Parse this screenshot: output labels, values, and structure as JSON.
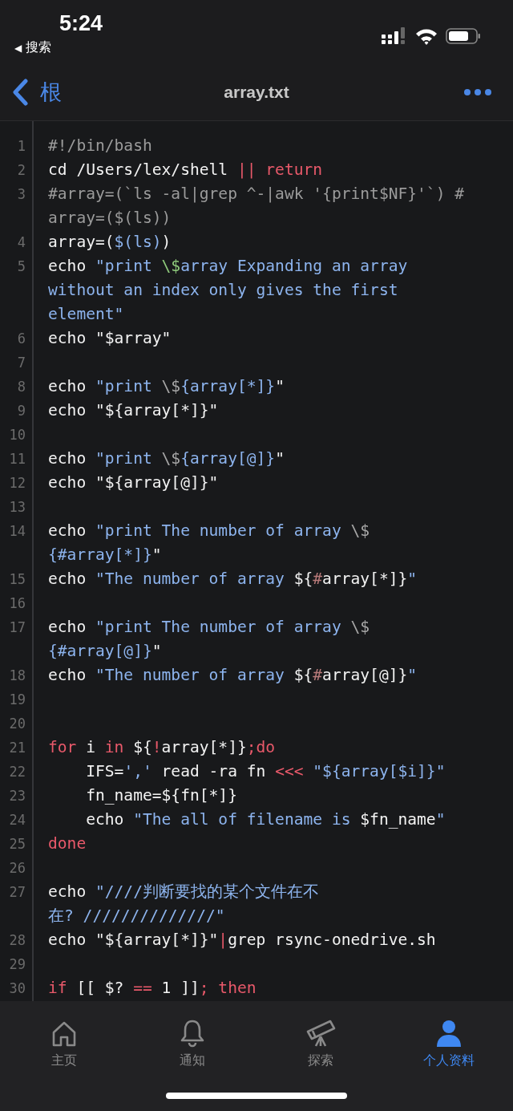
{
  "status_bar": {
    "time": "5:24",
    "back_arrow": "◀",
    "back_label": "搜索"
  },
  "nav_bar": {
    "back_label": "根",
    "title": "array.txt"
  },
  "code_lines": [
    {
      "number": "1",
      "rows": [
        [
          {
            "kind": "comment",
            "text": "#!/bin/bash"
          }
        ]
      ]
    },
    {
      "number": "2",
      "rows": [
        [
          {
            "kind": "plain",
            "text": "cd /Users/lex/shell "
          },
          {
            "kind": "keyword",
            "text": "|| return"
          }
        ]
      ]
    },
    {
      "number": "3",
      "rows": [
        [
          {
            "kind": "comment",
            "text": "#array=(`ls -al|grep ^-|awk '{print$NF}'`) #"
          }
        ],
        [
          {
            "kind": "comment",
            "text": "array=($(ls))"
          }
        ]
      ]
    },
    {
      "number": "4",
      "rows": [
        [
          {
            "kind": "plain",
            "text": "array=("
          },
          {
            "kind": "string",
            "text": "$(ls)"
          },
          {
            "kind": "plain",
            "text": ")"
          }
        ]
      ]
    },
    {
      "number": "5",
      "rows": [
        [
          {
            "kind": "plain",
            "text": "echo "
          },
          {
            "kind": "string",
            "text": "\"print "
          },
          {
            "kind": "escape",
            "text": "\\$"
          },
          {
            "kind": "string",
            "text": "array Expanding an array"
          }
        ],
        [
          {
            "kind": "string",
            "text": "without an index only gives the first"
          }
        ],
        [
          {
            "kind": "string",
            "text": "element\""
          }
        ]
      ]
    },
    {
      "number": "6",
      "rows": [
        [
          {
            "kind": "plain",
            "text": "echo \"$array\""
          }
        ]
      ]
    },
    {
      "number": "7"
    },
    {
      "number": "8",
      "rows": [
        [
          {
            "kind": "plain",
            "text": "echo "
          },
          {
            "kind": "string",
            "text": "\"print "
          },
          {
            "kind": "dim",
            "text": "\\$"
          },
          {
            "kind": "string",
            "text": "{array[*]}"
          },
          {
            "kind": "plain",
            "text": "\""
          }
        ]
      ]
    },
    {
      "number": "9",
      "rows": [
        [
          {
            "kind": "plain",
            "text": "echo \"${array[*]}\""
          }
        ]
      ]
    },
    {
      "number": "10"
    },
    {
      "number": "11",
      "rows": [
        [
          {
            "kind": "plain",
            "text": "echo "
          },
          {
            "kind": "string",
            "text": "\"print "
          },
          {
            "kind": "dim",
            "text": "\\$"
          },
          {
            "kind": "string",
            "text": "{array[@]}"
          },
          {
            "kind": "plain",
            "text": "\""
          }
        ]
      ]
    },
    {
      "number": "12",
      "rows": [
        [
          {
            "kind": "plain",
            "text": "echo \"${array[@]}\""
          }
        ]
      ]
    },
    {
      "number": "13"
    },
    {
      "number": "14",
      "rows": [
        [
          {
            "kind": "plain",
            "text": "echo "
          },
          {
            "kind": "string",
            "text": "\"print The number of array "
          },
          {
            "kind": "dim",
            "text": "\\$"
          }
        ],
        [
          {
            "kind": "string",
            "text": "{#array[*]}"
          },
          {
            "kind": "plain",
            "text": "\""
          }
        ]
      ]
    },
    {
      "number": "15",
      "rows": [
        [
          {
            "kind": "plain",
            "text": "echo "
          },
          {
            "kind": "string",
            "text": "\"The number of array "
          },
          {
            "kind": "plain",
            "text": "${"
          },
          {
            "kind": "hash",
            "text": "#"
          },
          {
            "kind": "plain",
            "text": "array[*]}"
          },
          {
            "kind": "string",
            "text": "\""
          }
        ]
      ]
    },
    {
      "number": "16"
    },
    {
      "number": "17",
      "rows": [
        [
          {
            "kind": "plain",
            "text": "echo "
          },
          {
            "kind": "string",
            "text": "\"print The number of array "
          },
          {
            "kind": "dim",
            "text": "\\$"
          }
        ],
        [
          {
            "kind": "string",
            "text": "{#array[@]}"
          },
          {
            "kind": "plain",
            "text": "\""
          }
        ]
      ]
    },
    {
      "number": "18",
      "rows": [
        [
          {
            "kind": "plain",
            "text": "echo "
          },
          {
            "kind": "string",
            "text": "\"The number of array "
          },
          {
            "kind": "plain",
            "text": "${"
          },
          {
            "kind": "hash",
            "text": "#"
          },
          {
            "kind": "plain",
            "text": "array[@]}"
          },
          {
            "kind": "string",
            "text": "\""
          }
        ]
      ]
    },
    {
      "number": "19"
    },
    {
      "number": "20"
    },
    {
      "number": "21",
      "rows": [
        [
          {
            "kind": "keyword",
            "text": "for"
          },
          {
            "kind": "plain",
            "text": " i "
          },
          {
            "kind": "keyword",
            "text": "in"
          },
          {
            "kind": "plain",
            "text": " ${"
          },
          {
            "kind": "keyword",
            "text": "!"
          },
          {
            "kind": "plain",
            "text": "array[*]}"
          },
          {
            "kind": "keyword",
            "text": ";do"
          }
        ]
      ]
    },
    {
      "number": "22",
      "rows": [
        [
          {
            "kind": "plain",
            "text": "    IFS="
          },
          {
            "kind": "string",
            "text": "','"
          },
          {
            "kind": "plain",
            "text": " read -ra fn "
          },
          {
            "kind": "keyword",
            "text": "<<<"
          },
          {
            "kind": "plain",
            "text": " "
          },
          {
            "kind": "string",
            "text": "\"${array[$i]}\""
          }
        ]
      ]
    },
    {
      "number": "23",
      "rows": [
        [
          {
            "kind": "plain",
            "text": "    fn_name=${fn[*]}"
          }
        ]
      ]
    },
    {
      "number": "24",
      "rows": [
        [
          {
            "kind": "plain",
            "text": "    echo "
          },
          {
            "kind": "string",
            "text": "\"The all of filename is "
          },
          {
            "kind": "plain",
            "text": "$fn_name"
          },
          {
            "kind": "string",
            "text": "\""
          }
        ]
      ]
    },
    {
      "number": "25",
      "rows": [
        [
          {
            "kind": "keyword",
            "text": "done"
          }
        ]
      ]
    },
    {
      "number": "26"
    },
    {
      "number": "27",
      "rows": [
        [
          {
            "kind": "plain",
            "text": "echo "
          },
          {
            "kind": "string",
            "text": "\"////判断要找的某个文件在不"
          }
        ],
        [
          {
            "kind": "string",
            "text": "在? //////////////\""
          }
        ]
      ]
    },
    {
      "number": "28",
      "rows": [
        [
          {
            "kind": "plain",
            "text": "echo \"${array[*]}\""
          },
          {
            "kind": "keyword",
            "text": "|"
          },
          {
            "kind": "plain",
            "text": "grep rsync-onedrive.sh"
          }
        ]
      ]
    },
    {
      "number": "29"
    },
    {
      "number": "30",
      "rows": [
        [
          {
            "kind": "keyword",
            "text": "if"
          },
          {
            "kind": "plain",
            "text": " [[ $? "
          },
          {
            "kind": "keyword",
            "text": "=="
          },
          {
            "kind": "plain",
            "text": " 1 ]]"
          },
          {
            "kind": "keyword",
            "text": "; then"
          }
        ]
      ]
    }
  ],
  "tab_bar": [
    {
      "label": "主页",
      "selected": false
    },
    {
      "label": "通知",
      "selected": false
    },
    {
      "label": "探索",
      "selected": false
    },
    {
      "label": "个人资料",
      "selected": true
    }
  ]
}
